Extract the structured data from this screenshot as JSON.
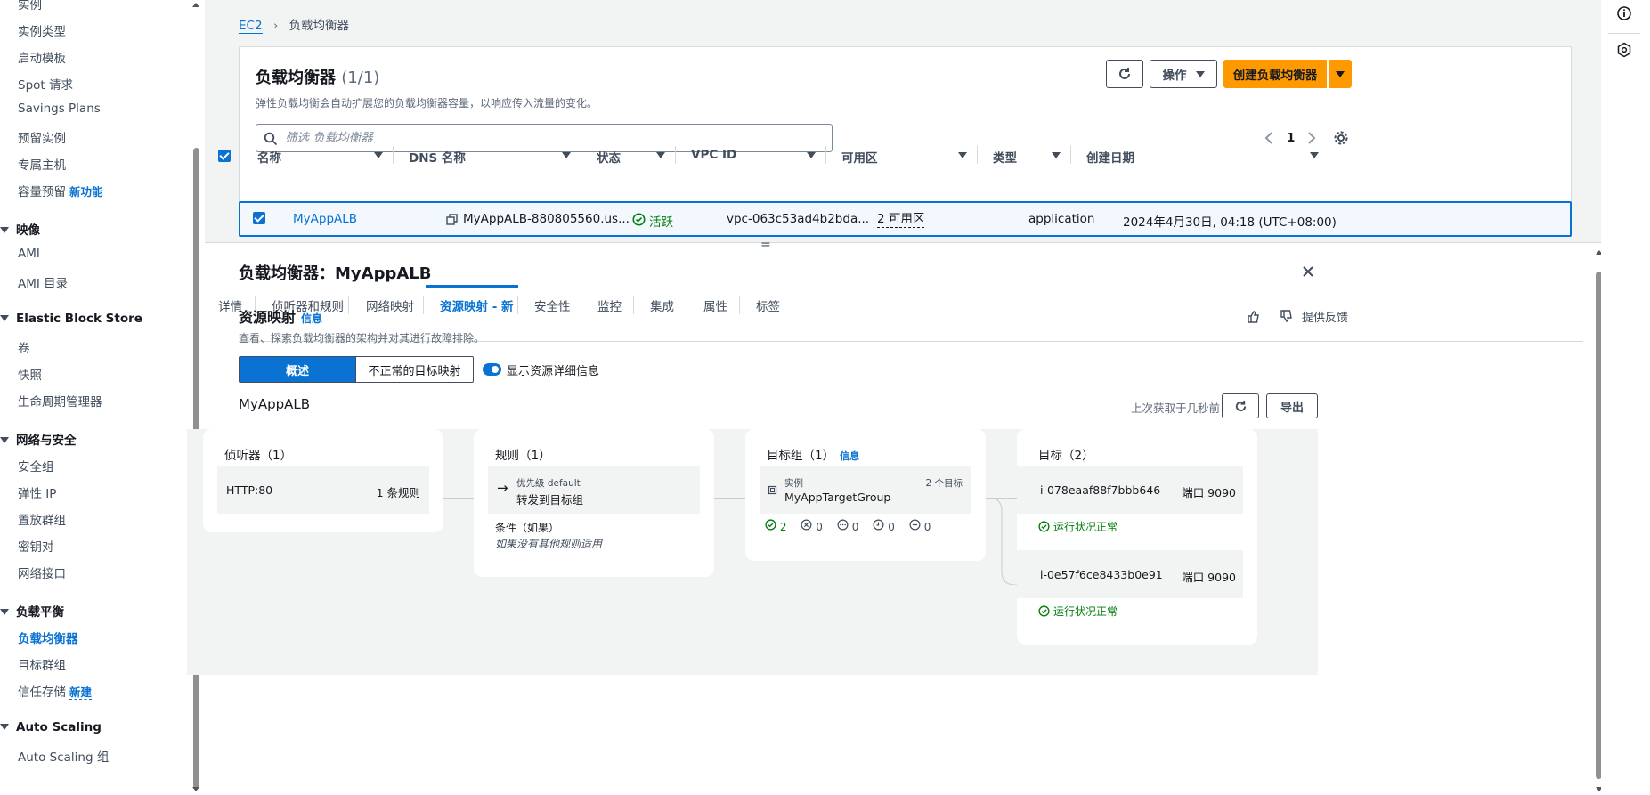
{
  "sidebar": {
    "top_items": [
      {
        "label": "实例"
      },
      {
        "label": "实例类型"
      },
      {
        "label": "启动模板"
      },
      {
        "label": "Spot 请求"
      },
      {
        "label": "Savings Plans"
      },
      {
        "label": "预留实例"
      },
      {
        "label": "专属主机"
      },
      {
        "label": "容量预留",
        "badge": "新功能"
      }
    ],
    "sections": [
      {
        "title": "映像",
        "items": [
          {
            "label": "AMI"
          },
          {
            "label": "AMI 目录"
          }
        ]
      },
      {
        "title": "Elastic Block Store",
        "items": [
          {
            "label": "卷"
          },
          {
            "label": "快照"
          },
          {
            "label": "生命周期管理器"
          }
        ]
      },
      {
        "title": "网络与安全",
        "items": [
          {
            "label": "安全组"
          },
          {
            "label": "弹性 IP"
          },
          {
            "label": "置放群组"
          },
          {
            "label": "密钥对"
          },
          {
            "label": "网络接口"
          }
        ]
      },
      {
        "title": "负载平衡",
        "items": [
          {
            "label": "负载均衡器"
          },
          {
            "label": "目标群组"
          },
          {
            "label": "信任存储",
            "badge": "新建"
          }
        ]
      },
      {
        "title": "Auto Scaling",
        "items": [
          {
            "label": "Auto Scaling 组"
          }
        ]
      }
    ]
  },
  "breadcrumb": {
    "root": "EC2",
    "current": "负载均衡器"
  },
  "lb_list": {
    "title": "负载均衡器",
    "count": "(1/1)",
    "description": "弹性负载均衡会自动扩展您的负载均衡器容量，以响应传入流量的变化。",
    "actions_label": "操作",
    "create_label": "创建负载均衡器",
    "filter_placeholder": "筛选 负载均衡器",
    "page": "1",
    "columns": [
      "名称",
      "DNS 名称",
      "状态",
      "VPC ID",
      "可用区",
      "类型",
      "创建日期"
    ],
    "row": {
      "name": "MyAppALB",
      "dns": "MyAppALB-880805560.us...",
      "state": "活跃",
      "vpc": "vpc-063c53ad4b2bda...",
      "az": "2 可用区",
      "type": "application",
      "created": "2024年4月30日, 04:18 (UTC+08:00)"
    }
  },
  "details": {
    "title": "负载均衡器：MyAppALB",
    "tabs": [
      "详情",
      "侦听器和规则",
      "网络映射",
      "资源映射 - 新",
      "安全性",
      "监控",
      "集成",
      "属性",
      "标签"
    ],
    "active_tab": "资源映射 - 新"
  },
  "resource_map": {
    "title": "资源映射",
    "info": "信息",
    "description": "查看、探索负载均衡器的架构并对其进行故障排除。",
    "feedback": "提供反馈",
    "seg_overview": "概述",
    "seg_unhealthy": "不正常的目标映射",
    "toggle_label": "显示资源详细信息",
    "alb_name": "MyAppALB",
    "last_fetched": "上次获取于几秒前",
    "export": "导出",
    "listeners": {
      "title": "侦听器（1）",
      "protocol": "HTTP:80",
      "rules": "1 条规则"
    },
    "rules": {
      "title": "规则（1）",
      "priority": "优先级 default",
      "action": "转发到目标组",
      "cond_title": "条件（如果）",
      "cond_text": "如果没有其他规则适用"
    },
    "target_groups": {
      "title": "目标组（1）",
      "info": "信息",
      "kind": "实例",
      "targets_count": "2 个目标",
      "name": "MyAppTargetGroup",
      "stats": {
        "healthy": "2",
        "unhealthy": "0",
        "unused": "0",
        "initial": "0",
        "draining": "0"
      }
    },
    "targets": {
      "title": "目标（2）",
      "items": [
        {
          "id": "i-078eaaf88f7bbb646",
          "port": "端口 9090",
          "status": "运行状况正常"
        },
        {
          "id": "i-0e57f6ce8433b0e91",
          "port": "端口 9090",
          "status": "运行状况正常"
        }
      ]
    }
  }
}
